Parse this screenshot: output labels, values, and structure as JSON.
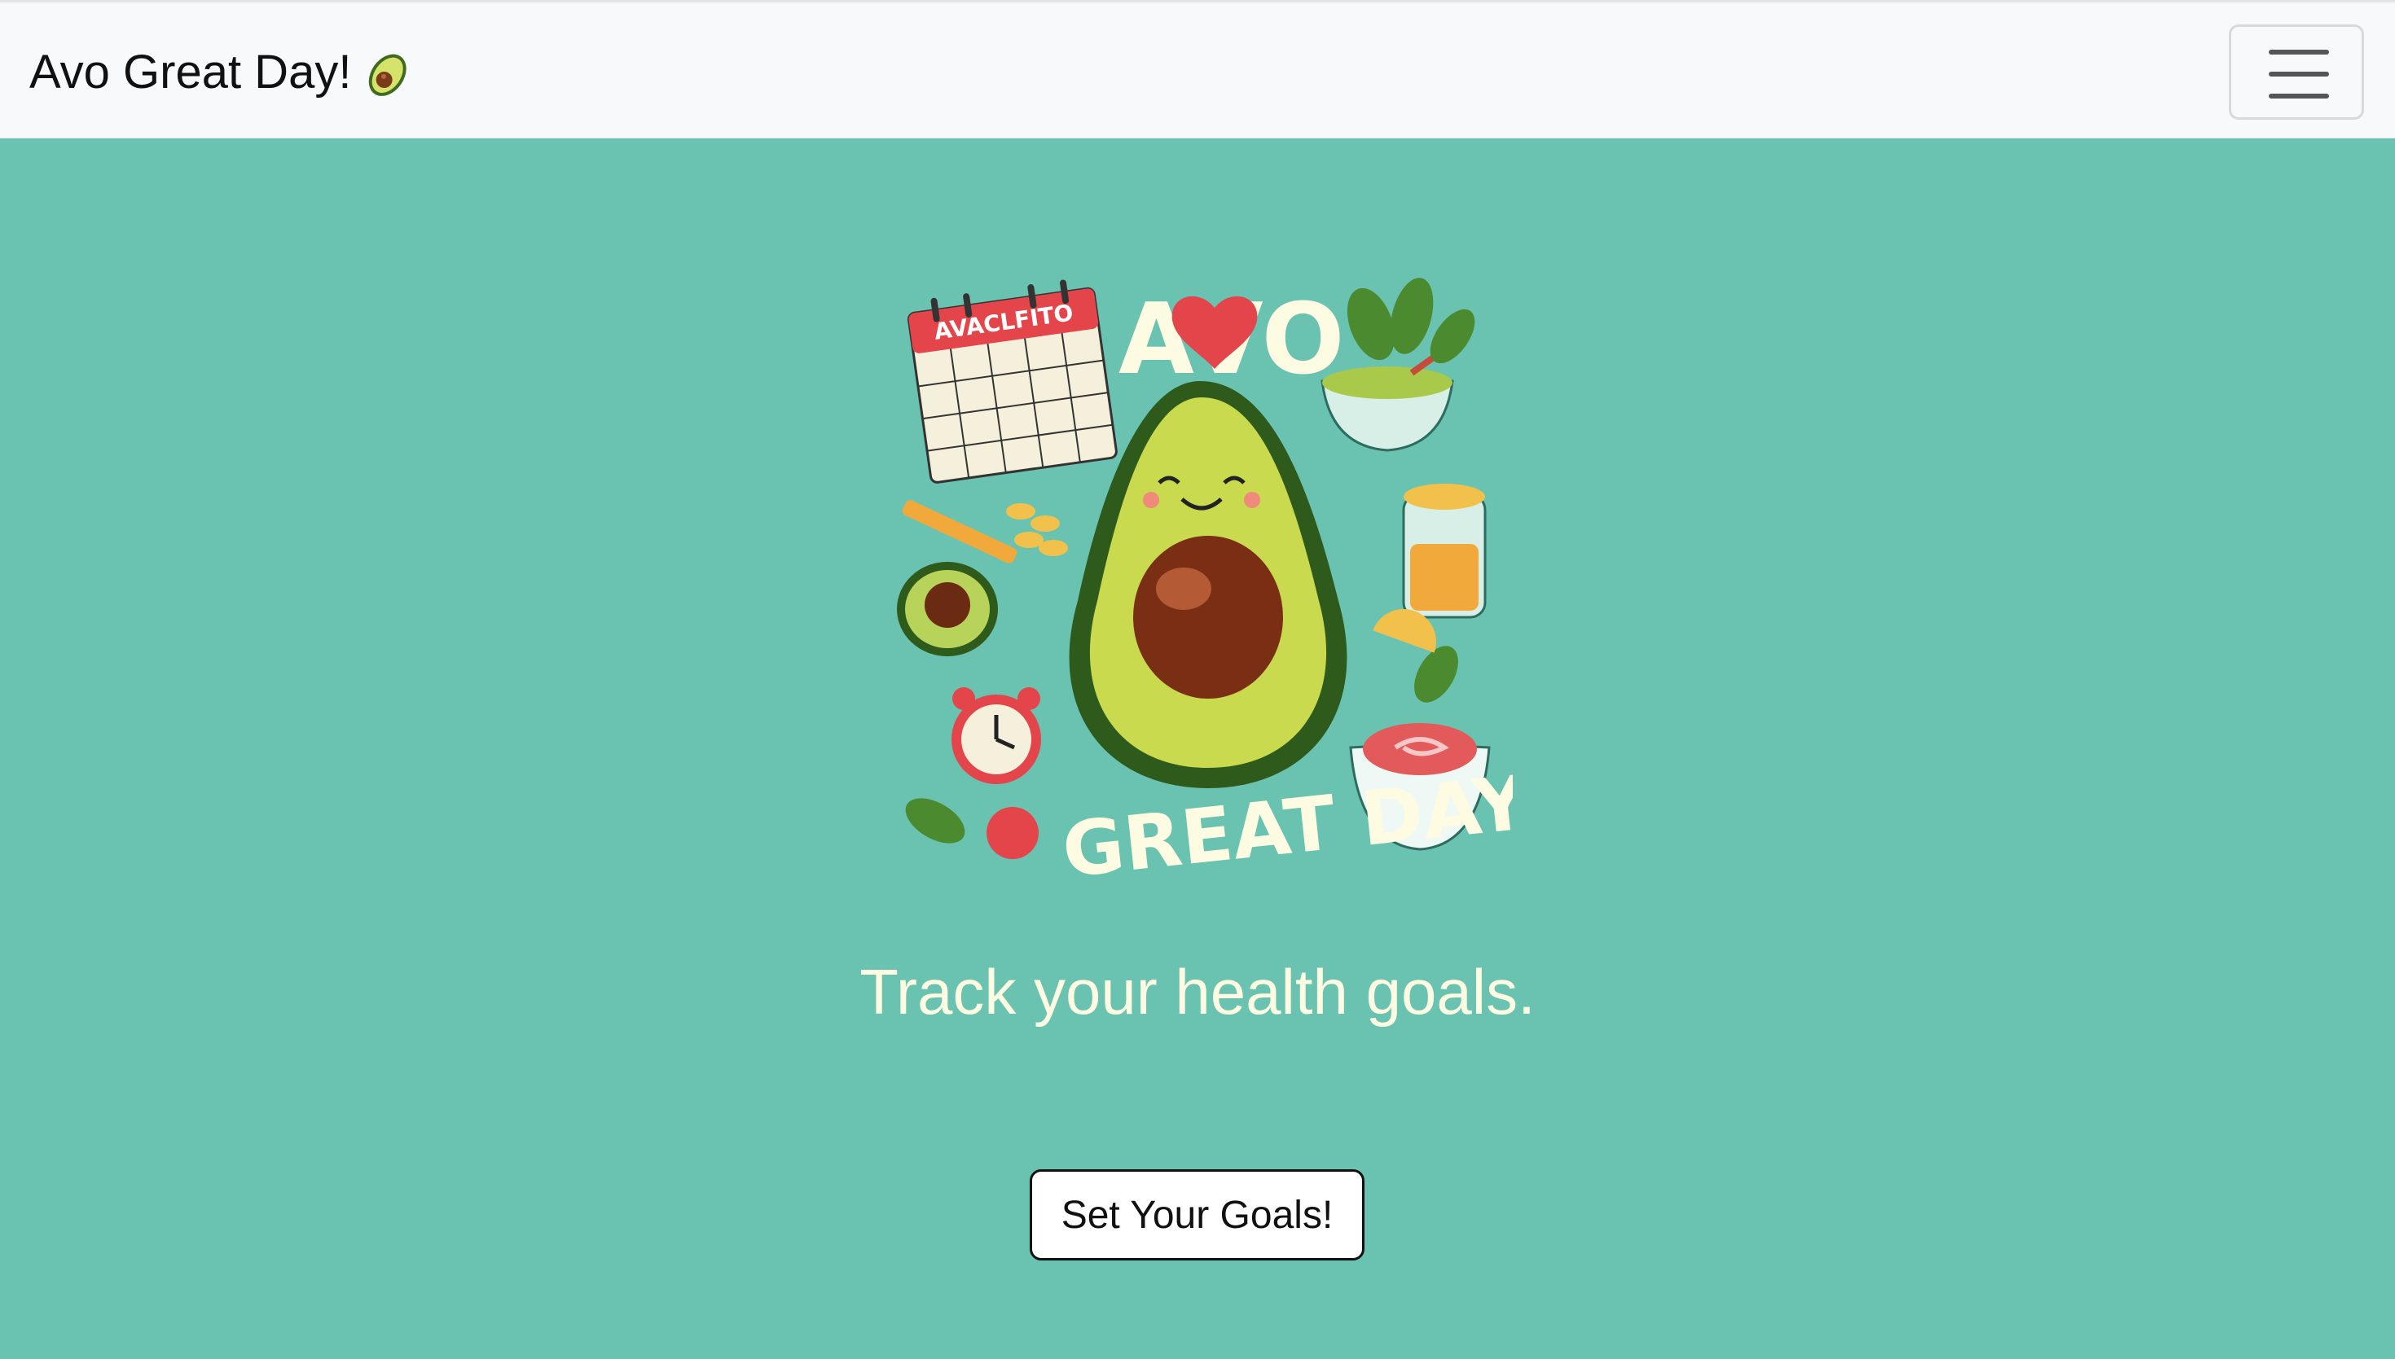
{
  "navbar": {
    "brand_text": "Avo Great Day!",
    "brand_icon": "avocado-icon",
    "toggler_icon": "hamburger-menu-icon"
  },
  "hero": {
    "image_subject": "avocado-illustration",
    "image_text_top": "AVO",
    "image_text_bottom": "GREAT DAY!",
    "calendar_header": "AVACLFITO",
    "tagline": "Track your health goals.",
    "cta_label": "Set Your Goals!"
  },
  "colors": {
    "background": "#6ac3b0",
    "navbar_bg": "#f8f9fa",
    "tagline": "#fdfbe1",
    "button_bg": "#ffffff",
    "button_border": "#111111"
  }
}
